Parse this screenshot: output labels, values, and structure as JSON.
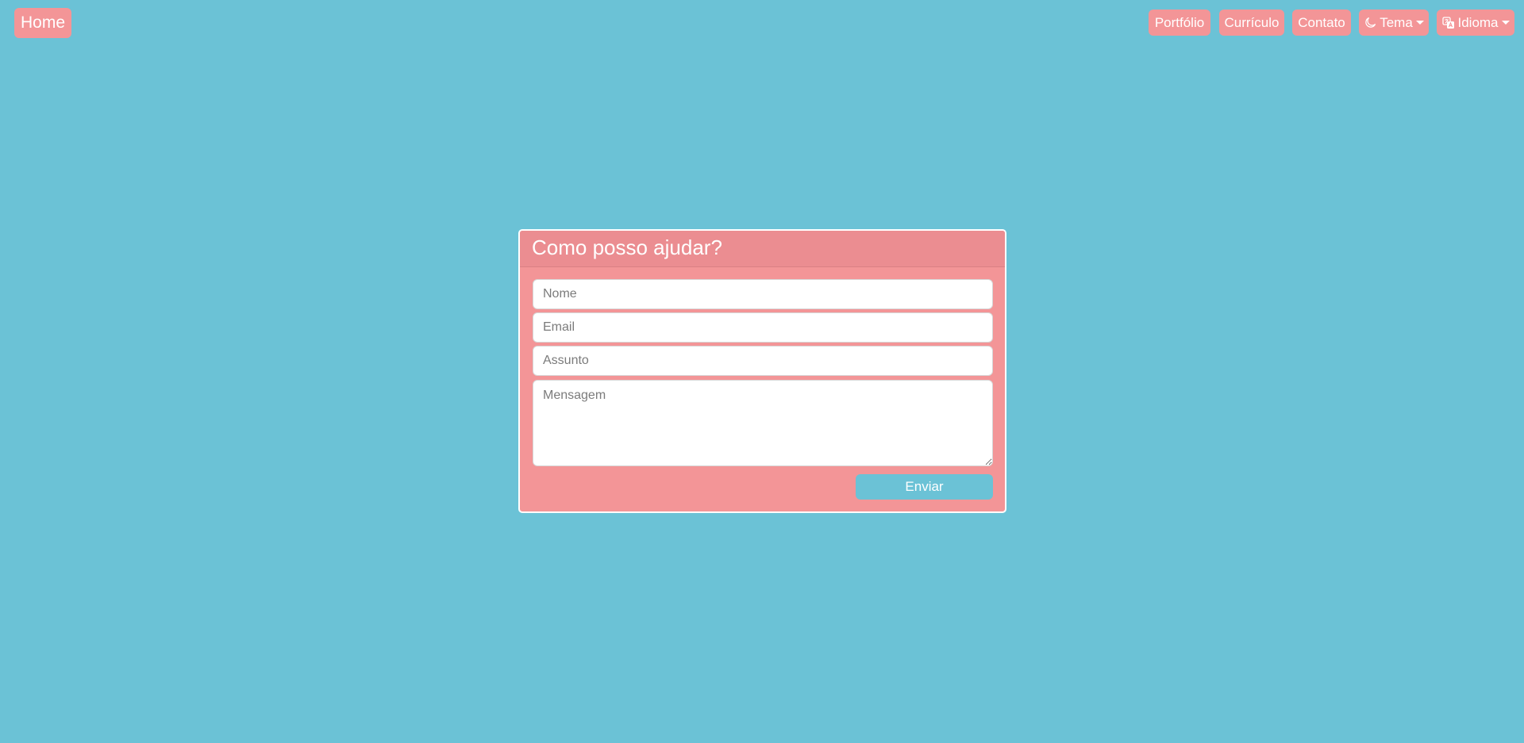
{
  "colors": {
    "background": "#6bc2d6",
    "accent": "#f39597",
    "card_header": "#eb8d91",
    "text_on_accent": "#ffffff"
  },
  "nav": {
    "home_label": "Home",
    "items": [
      {
        "label": "Portfólio"
      },
      {
        "label": "Currículo"
      },
      {
        "label": "Contato"
      }
    ],
    "theme": {
      "label": "Tema",
      "icon": "moon-icon"
    },
    "language": {
      "label": "Idioma",
      "icon": "translate-icon"
    }
  },
  "contact_form": {
    "title": "Como posso ajudar?",
    "name_placeholder": "Nome",
    "email_placeholder": "Email",
    "subject_placeholder": "Assunto",
    "message_placeholder": "Mensagem",
    "submit_label": "Enviar"
  }
}
